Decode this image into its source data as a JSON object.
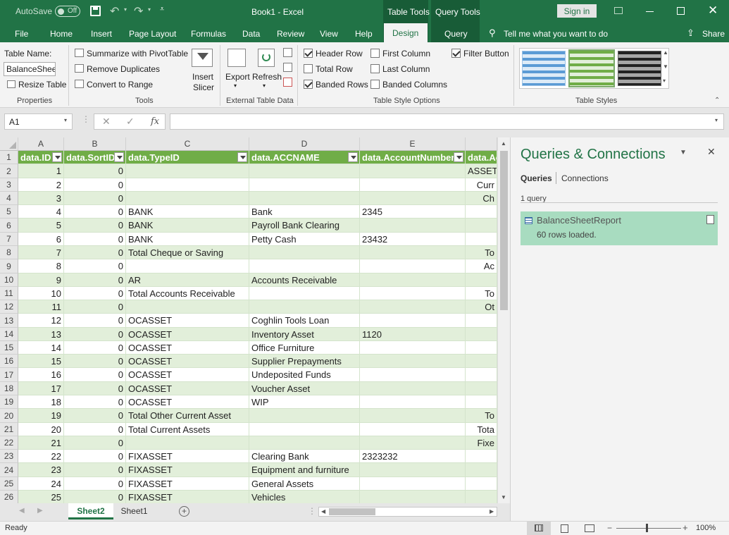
{
  "titlebar": {
    "autosave": "AutoSave",
    "toggle": "Off",
    "doc_title": "Book1  -  Excel",
    "table_tools": "Table Tools",
    "query_tools": "Query Tools",
    "signin": "Sign in"
  },
  "tabs": [
    "File",
    "Home",
    "Insert",
    "Page Layout",
    "Formulas",
    "Data",
    "Review",
    "View",
    "Help",
    "Design",
    "Query"
  ],
  "tell_me": "Tell me what you want to do",
  "share": "Share",
  "ribbon": {
    "properties": {
      "table_name_label": "Table Name:",
      "table_name_value": "BalanceSheetF",
      "resize": "Resize Table",
      "group": "Properties"
    },
    "tools": {
      "summarize": "Summarize with PivotTable",
      "remove_dup": "Remove Duplicates",
      "convert": "Convert to Range",
      "insert_slicer_1": "Insert",
      "insert_slicer_2": "Slicer",
      "group": "Tools"
    },
    "external": {
      "export": "Export",
      "refresh": "Refresh",
      "group": "External Table Data"
    },
    "style_options": {
      "header_row": "Header Row",
      "total_row": "Total Row",
      "banded_rows": "Banded Rows",
      "first_column": "First Column",
      "last_column": "Last Column",
      "banded_columns": "Banded Columns",
      "filter_button": "Filter Button",
      "group": "Table Style Options"
    },
    "styles": {
      "group": "Table Styles"
    }
  },
  "namebox": "A1",
  "fx": "fx",
  "columns": [
    "A",
    "B",
    "C",
    "D",
    "E"
  ],
  "headers": [
    "data.ID",
    "data.SortID",
    "data.TypeID",
    "data.ACCNAME",
    "data.AccountNumber",
    "data.Ac"
  ],
  "rows": [
    [
      "1",
      "0",
      "",
      "",
      "",
      "ASSETS"
    ],
    [
      "2",
      "0",
      "",
      "",
      "",
      "Curr"
    ],
    [
      "3",
      "0",
      "",
      "",
      "",
      "Ch"
    ],
    [
      "4",
      "0",
      "BANK",
      "Bank",
      "2345",
      ""
    ],
    [
      "5",
      "0",
      "BANK",
      "Payroll Bank Clearing",
      "",
      ""
    ],
    [
      "6",
      "0",
      "BANK",
      "Petty Cash",
      "23432",
      ""
    ],
    [
      "7",
      "0",
      "Total Cheque or Saving",
      "",
      "",
      "To"
    ],
    [
      "8",
      "0",
      "",
      "",
      "",
      "Ac"
    ],
    [
      "9",
      "0",
      "AR",
      "Accounts Receivable",
      "",
      ""
    ],
    [
      "10",
      "0",
      "Total Accounts Receivable",
      "",
      "",
      "To"
    ],
    [
      "11",
      "0",
      "",
      "",
      "",
      "Ot"
    ],
    [
      "12",
      "0",
      "OCASSET",
      "Coghlin Tools Loan",
      "",
      ""
    ],
    [
      "13",
      "0",
      "OCASSET",
      "Inventory Asset",
      "1120",
      ""
    ],
    [
      "14",
      "0",
      "OCASSET",
      "Office Furniture",
      "",
      ""
    ],
    [
      "15",
      "0",
      "OCASSET",
      "Supplier Prepayments",
      "",
      ""
    ],
    [
      "16",
      "0",
      "OCASSET",
      "Undeposited Funds",
      "",
      ""
    ],
    [
      "17",
      "0",
      "OCASSET",
      "Voucher Asset",
      "",
      ""
    ],
    [
      "18",
      "0",
      "OCASSET",
      "WIP",
      "",
      ""
    ],
    [
      "19",
      "0",
      "Total Other Current Asset",
      "",
      "",
      "To"
    ],
    [
      "20",
      "0",
      "Total Current Assets",
      "",
      "",
      "Tota"
    ],
    [
      "21",
      "0",
      "",
      "",
      "",
      "Fixe"
    ],
    [
      "22",
      "0",
      "FIXASSET",
      "Clearing Bank",
      "2323232",
      ""
    ],
    [
      "23",
      "0",
      "FIXASSET",
      "Equipment and furniture",
      "",
      ""
    ],
    [
      "24",
      "0",
      "FIXASSET",
      "General Assets",
      "",
      ""
    ],
    [
      "25",
      "0",
      "FIXASSET",
      "Vehicles",
      "",
      ""
    ]
  ],
  "row_numbers": [
    "1",
    "2",
    "3",
    "4",
    "5",
    "6",
    "7",
    "8",
    "9",
    "10",
    "11",
    "12",
    "13",
    "14",
    "15",
    "16",
    "17",
    "18",
    "19",
    "20",
    "21",
    "22",
    "23",
    "24",
    "25",
    "26"
  ],
  "sheets": [
    "Sheet2",
    "Sheet1"
  ],
  "pane": {
    "title": "Queries & Connections",
    "tab_queries": "Queries",
    "tab_connections": "Connections",
    "count": "1 query",
    "query_name": "BalanceSheetReport",
    "query_status": "60 rows loaded."
  },
  "status": {
    "ready": "Ready",
    "zoom": "100%"
  },
  "colors": {
    "excel_green": "#217346",
    "header_green": "#70ad47",
    "band_green": "#e2efda",
    "query_green": "#a8dcc0"
  }
}
